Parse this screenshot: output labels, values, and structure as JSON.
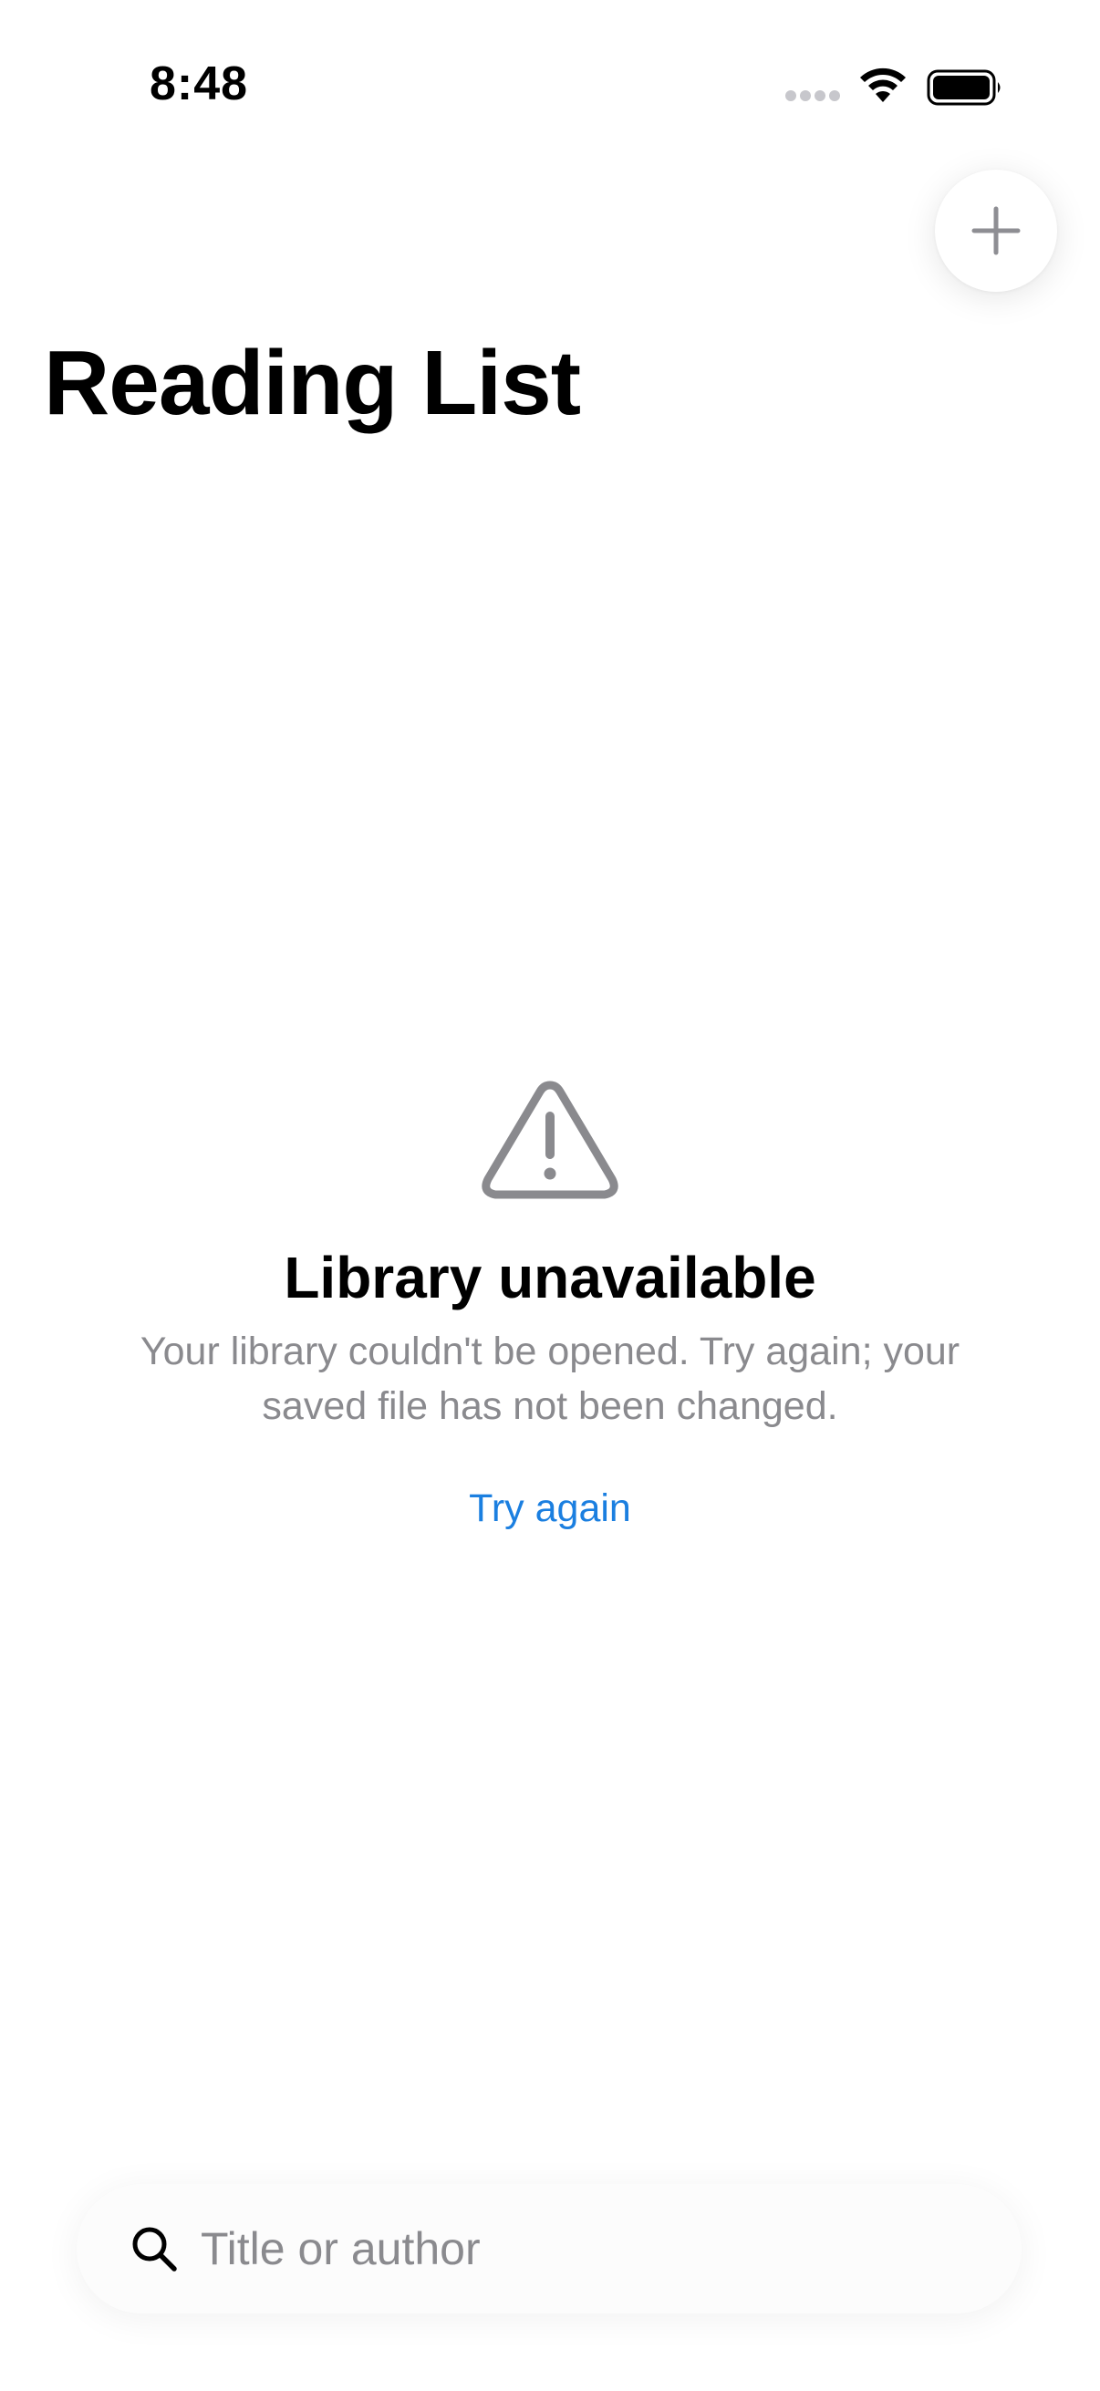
{
  "status_bar": {
    "time": "8:48",
    "icons": [
      "cellular-signal-icon",
      "wifi-icon",
      "battery-icon"
    ]
  },
  "header": {
    "title": "Reading List",
    "add_button_icon": "plus-icon"
  },
  "error_state": {
    "icon": "warning-triangle-icon",
    "title": "Library unavailable",
    "message": "Your library couldn't be opened. Try again; your saved file has not been changed.",
    "action_label": "Try again"
  },
  "search": {
    "icon": "search-icon",
    "placeholder": "Title or author",
    "value": ""
  },
  "colors": {
    "accent": "#1b7fe0",
    "secondary_text": "#8a8a8e",
    "icon_gray": "#8a8a8e",
    "background": "#ffffff"
  }
}
